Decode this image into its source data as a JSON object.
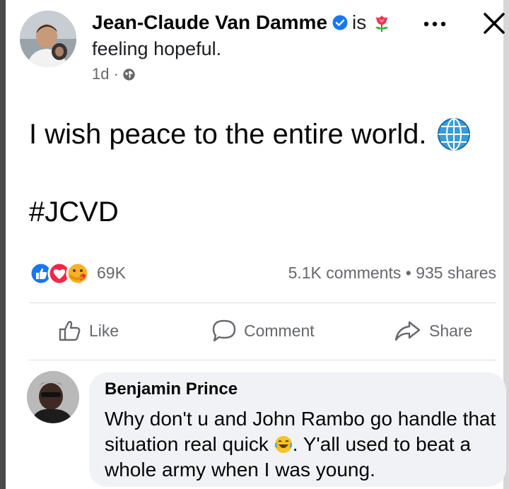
{
  "post": {
    "author": "Jean-Claude Van Damme",
    "is": "is",
    "feeling": "feeling hopeful.",
    "time": "1d ·",
    "text": "I wish peace to the entire world.",
    "hashtag": "#JCVD",
    "reaction_count": "69K",
    "stats": "5.1K comments • 935 shares"
  },
  "actions": {
    "like": "Like",
    "comment": "Comment",
    "share": "Share"
  },
  "comment": {
    "author": "Benjamin Prince",
    "text_1": "Why don't u and John Rambo go handle that situation real quick ",
    "text_2": ". Y'all used to beat a whole army when I was young."
  },
  "colors": {
    "text": "#050505",
    "secondary": "#65676b",
    "verified_blue": "#1877f2",
    "bubble": "#f0f2f5"
  },
  "icons": [
    "verified-icon",
    "flower-emoji-icon",
    "globe-icon",
    "more-dots-icon",
    "close-icon",
    "like-reaction-icon",
    "love-reaction-icon",
    "care-reaction-icon",
    "thumbs-up-icon",
    "comment-icon",
    "share-icon",
    "laughing-emoji-icon"
  ]
}
